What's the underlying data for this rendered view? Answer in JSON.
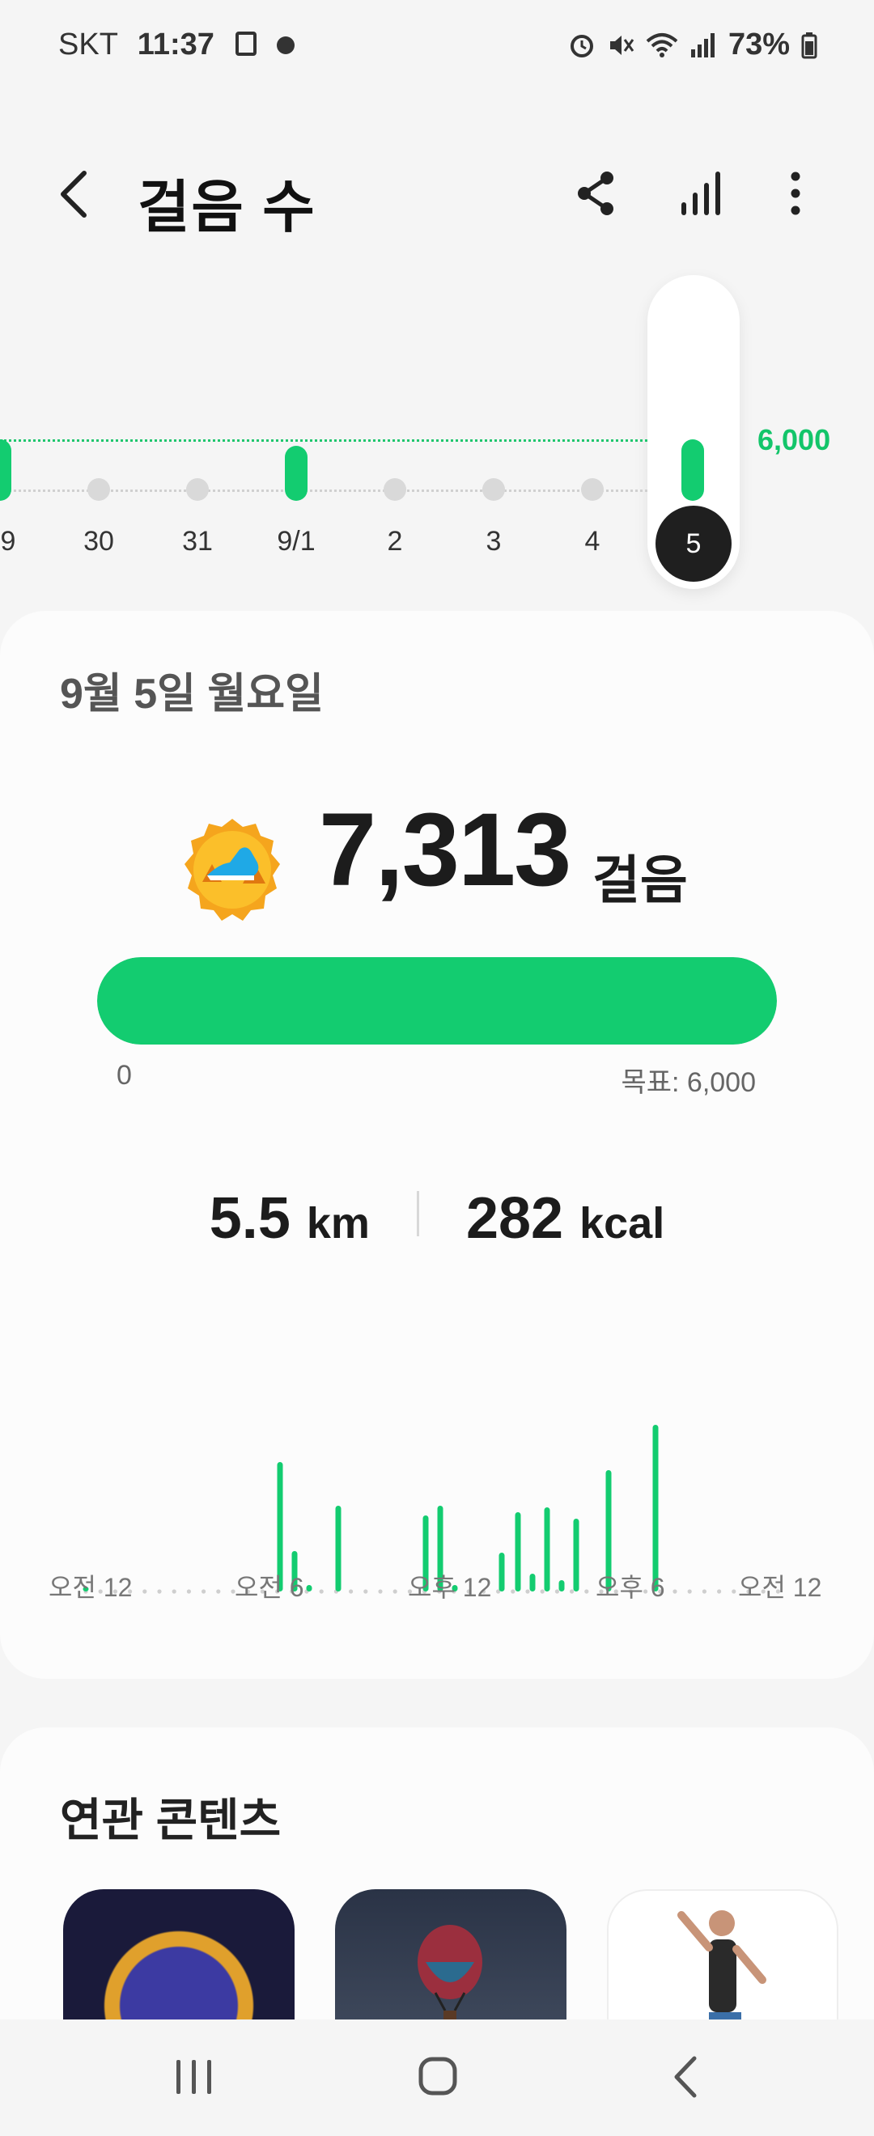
{
  "status_bar": {
    "carrier": "SKT",
    "time": "11:37",
    "battery": "73%"
  },
  "header": {
    "title": "걸음 수",
    "back_icon": "chevron-left-icon",
    "share_icon": "share-icon",
    "stats_icon": "bar-chart-icon",
    "more_icon": "more-vertical-icon"
  },
  "week_selector": {
    "days": [
      "9",
      "30",
      "31",
      "9/1",
      "2",
      "3",
      "4",
      "5"
    ],
    "selected_index": 7,
    "goal_label": "6,000",
    "bar_fraction_of_goal": [
      1.22,
      0.18,
      0.12,
      1.1,
      0.06,
      0.06,
      0.06,
      1.22
    ],
    "goal_met": [
      true,
      false,
      false,
      true,
      false,
      false,
      false,
      true
    ]
  },
  "summary": {
    "date": "9월 5일 월요일",
    "steps": "7,313",
    "steps_unit": "걸음",
    "progress_fraction": 1.0,
    "progress_min": "0",
    "progress_goal": "목표: 6,000",
    "distance_value": "5.5",
    "distance_unit": "km",
    "calories_value": "282",
    "calories_unit": "kcal"
  },
  "hourly_chart": {
    "time_labels": [
      "오전 12",
      "오전 6",
      "오후 12",
      "오후 6",
      "오전 12"
    ]
  },
  "related": {
    "title": "연관 콘텐츠"
  },
  "colors": {
    "accent": "#13cc70",
    "inactive_bar": "#d9d9d9",
    "selected_day_bg": "#1f1f1f"
  }
}
